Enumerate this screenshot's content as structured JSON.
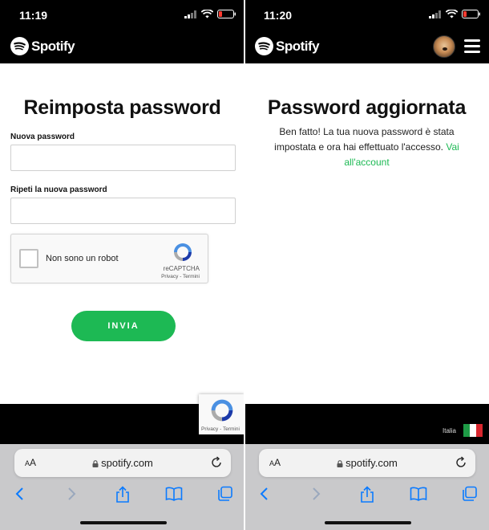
{
  "colors": {
    "accent": "#1db954",
    "bar": "#000000"
  },
  "left": {
    "status": {
      "time": "11:19"
    },
    "brand": "Spotify",
    "title": "Reimposta password",
    "fields": [
      {
        "label": "Nuova password",
        "value": ""
      },
      {
        "label": "Ripeti la nuova password",
        "value": ""
      }
    ],
    "recaptcha": {
      "label": "Non sono un robot",
      "brand": "reCAPTCHA",
      "links": "Privacy - Termini"
    },
    "submit_label": "INVIA",
    "badge_links": "Privacy - Termini",
    "browser": {
      "aa": "AA",
      "url": "spotify.com"
    }
  },
  "right": {
    "status": {
      "time": "11:20"
    },
    "brand": "Spotify",
    "title": "Password aggiornata",
    "message": "Ben fatto! La tua nuova password è stata impostata e ora hai effettuato l'accesso.",
    "link": "Vai all'account",
    "footer": {
      "country": "Italia"
    },
    "browser": {
      "aa": "AA",
      "url": "spotify.com"
    }
  }
}
